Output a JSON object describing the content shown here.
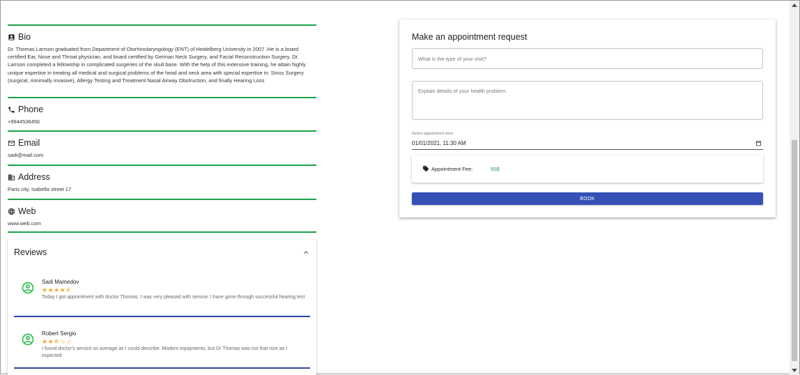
{
  "profile": {
    "bio": {
      "heading": "Bio",
      "text": "Dr. Thomas Larrson graduated from Department of Otorhinolaryngology (ENT) of Heidelberg University in 2007 .He is a board certified Ear, Nose and Throat physician, and board certified by German Neck Surgery, and Facial Reconstruction Surgery. Dr. Larrson completed a fellowship in complicated surgeries of the skull base. With the help of this extensive training, he attain highly unique expertise in treating all medical and surgical problems of the head and neck area with special expertise in: Sinus Surgery (surgical, minimally invasive), Allergy Testing and Treatment Nasal Airway Obstruction, and finally Hearing Loss"
    },
    "phone": {
      "heading": "Phone",
      "value": "+9944536456"
    },
    "email": {
      "heading": "Email",
      "value": "sadi@mail.com"
    },
    "address": {
      "heading": "Address",
      "value": "Paris city, Isabella street 17"
    },
    "web": {
      "heading": "Web",
      "value": "www.web.com"
    }
  },
  "reviews": {
    "title": "Reviews",
    "items": [
      {
        "name": "Sadi Mamedov",
        "stars": "★★★★⯪",
        "rating": 4.5,
        "comment": "Today I got appointment with doctor Thomas. I was very pleased with service. I have gone through successful hearing test"
      },
      {
        "name": "Robert Sergio",
        "stars": "★★⯪☆☆",
        "rating": 2.5,
        "comment": "I found doctor's service as average as I could describe. Modern equipments, but Dr Thomas was not that nice as I expected"
      }
    ]
  },
  "appointment": {
    "title": "Make an appointment request",
    "visit_type_placeholder": "What is the type of your visit?",
    "details_placeholder": "Explain details of your health problem.",
    "datetime_label": "Select appointment time.",
    "datetime_value": "01/01/2021, 11:30 AM",
    "fee_label": "Appointment Fee:",
    "fee_value": "50$",
    "book_label": "BOOK"
  },
  "colors": {
    "divider_green": "#1aa34a",
    "review_rule_blue": "#2d47a8",
    "primary_button": "#3551b5",
    "star": "#f5a623",
    "avatar": "#2bbf4f"
  }
}
